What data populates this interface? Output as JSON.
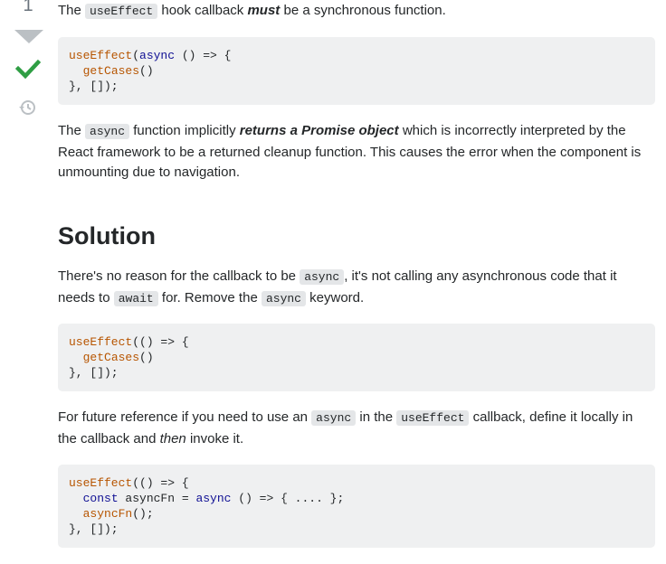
{
  "vote": {
    "count": "1"
  },
  "p1": {
    "t1": "The ",
    "c1": "useEffect",
    "t2": " hook callback ",
    "em": "must",
    "t3": " be a synchronous function."
  },
  "code1": {
    "l1a": "useEffect",
    "l1b": "(",
    "l1c": "async",
    "l1d": " () => {",
    "l2a": "  ",
    "l2b": "getCases",
    "l2c": "()",
    "l3": "}, []);"
  },
  "p2": {
    "t1": "The ",
    "c1": "async",
    "t2": " function implicitly ",
    "em": "returns a Promise object",
    "t3": " which is incorrectly interpreted by the React framework to be a returned cleanup function. This causes the error when the component is unmounting due to navigation."
  },
  "heading": "Solution",
  "p3": {
    "t1": "There's no reason for the callback to be ",
    "c1": "async",
    "t2": ", it's not calling any asynchronous code that it needs to ",
    "c2": "await",
    "t3": " for. Remove the ",
    "c3": "async",
    "t4": " keyword."
  },
  "code2": {
    "l1a": "useEffect",
    "l1b": "(() => {",
    "l2a": "  ",
    "l2b": "getCases",
    "l2c": "()",
    "l3": "}, []);"
  },
  "p4": {
    "t1": "For future reference if you need to use an ",
    "c1": "async",
    "t2": " in the ",
    "c2": "useEffect",
    "t3": " callback, define it locally in the callback and ",
    "em": "then",
    "t4": " invoke it."
  },
  "code3": {
    "l1a": "useEffect",
    "l1b": "(() => {",
    "l2a": "  ",
    "l2b": "const",
    "l2c": " asyncFn = ",
    "l2d": "async",
    "l2e": " () => { .... };",
    "l3a": "  ",
    "l3b": "asyncFn",
    "l3c": "();",
    "l4": "}, []);"
  },
  "colors": {
    "keyword": "#101094",
    "function": "#b75501",
    "accepted": "#2f9e44"
  }
}
